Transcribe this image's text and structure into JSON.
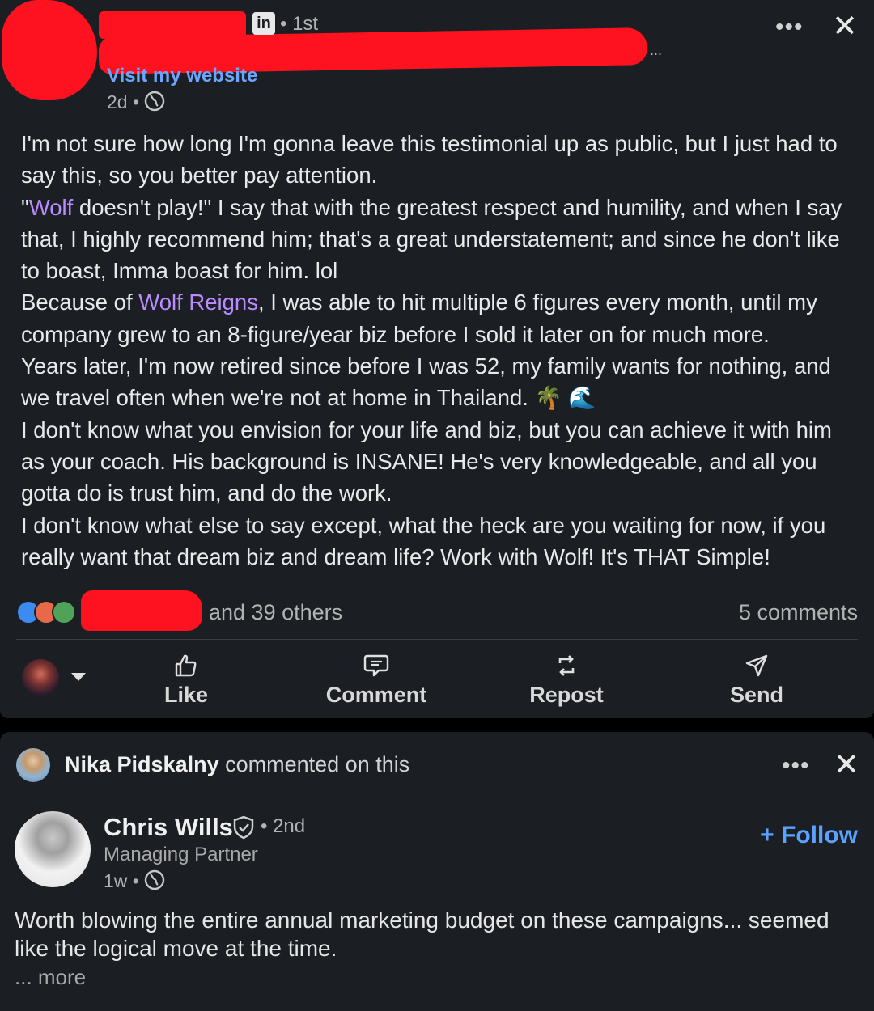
{
  "post": {
    "connection_badge": "in",
    "degree": "• 1st",
    "overflow_dots": "...",
    "name_truncation": "...",
    "more_label": "•••",
    "close_label": "✕",
    "visit_website": "Visit my website",
    "time": "2d •",
    "text": {
      "line1": "I'm not sure how long I'm gonna leave this testimonial up as public, but I just had to say this, so you better pay attention.",
      "quote_open": "\"",
      "mention1": "Wolf",
      "quote_rest": " doesn't play!\" I say that with the greatest respect and humility, and when I say that, I highly recommend him; that's a great understatement; and since he don't like to boast, Imma boast for him. lol",
      "because_prefix": "Because of ",
      "mention2": "Wolf Reigns",
      "because_rest": ", I was able to hit multiple 6 figures every month, until my company grew to an 8-figure/year biz before I sold it later on for much more.",
      "years": "Years later, I'm now retired since before I was 52, my family wants for nothing, and we travel often when we're not at home in Thailand. 🌴 🌊",
      "envision": "I don't know what you envision for your life and biz, but you can achieve it with him as your coach. His background is INSANE! He's very knowledgeable, and all you gotta do is trust him, and do the work.",
      "closing": "I don't know what else to say except, what the heck are you waiting for now, if you really want that dream biz and dream life? Work with Wolf! It's THAT Simple!"
    },
    "reactions": {
      "icons": [
        "like-reaction-icon",
        "love-reaction-icon",
        "celebrate-reaction-icon"
      ],
      "others": "and 39 others",
      "comments": "5 comments"
    },
    "actions": [
      {
        "label": "Like",
        "icon": "like-icon"
      },
      {
        "label": "Comment",
        "icon": "comment-icon"
      },
      {
        "label": "Repost",
        "icon": "repost-icon"
      },
      {
        "label": "Send",
        "icon": "send-icon"
      }
    ]
  },
  "comment_card": {
    "commenter": "Nika Pidskalny",
    "activity": " commented on this",
    "more_label": "•••",
    "close_label": "✕",
    "author": "Chris Wills",
    "degree": "• 2nd",
    "title": "Managing Partner",
    "time": "1w •",
    "follow": "+ Follow",
    "text": "Worth blowing the entire annual marketing budget on these campaigns... seemed like the logical move at the time.",
    "more": "... more"
  },
  "colors": {
    "background": "#000000",
    "card": "#1b1f23",
    "mention": "#b98cff",
    "link": "#6aa6ff",
    "follow": "#5aa2ff",
    "redaction": "#ff1220"
  }
}
